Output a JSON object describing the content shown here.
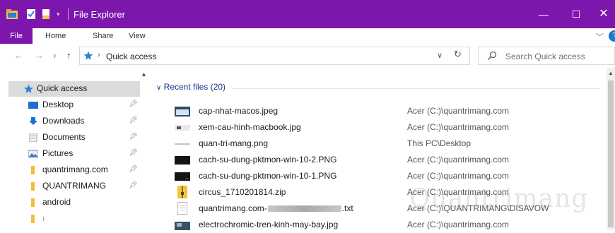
{
  "window": {
    "title": "File Explorer",
    "controls": {
      "minimize": "—",
      "maximize": "☐",
      "close": "✕"
    }
  },
  "ribbon": {
    "tabs": [
      "File",
      "Home",
      "Share",
      "View"
    ],
    "help": "?"
  },
  "address": {
    "location": "Quick access",
    "search_placeholder": "Search Quick access"
  },
  "sidebar": {
    "items": [
      {
        "label": "Quick access",
        "icon": "star-icon",
        "selected": true,
        "pinned": false
      },
      {
        "label": "Desktop",
        "icon": "desktop-icon",
        "pinned": true
      },
      {
        "label": "Downloads",
        "icon": "download-icon",
        "pinned": true
      },
      {
        "label": "Documents",
        "icon": "document-icon",
        "pinned": true
      },
      {
        "label": "Pictures",
        "icon": "picture-icon",
        "pinned": true
      },
      {
        "label": "quantrimang.com",
        "icon": "folder-icon",
        "pinned": true
      },
      {
        "label": "QUANTRIMANG",
        "icon": "folder-icon",
        "pinned": true
      },
      {
        "label": "android",
        "icon": "folder-icon",
        "pinned": false
      },
      {
        "label": "ı",
        "icon": "folder-icon",
        "pinned": false
      }
    ]
  },
  "recent": {
    "header": "Recent files (20)",
    "files": [
      {
        "name": "cap-nhat-macos.jpeg",
        "location": "Acer (C:)\\quantrimang.com",
        "icon": "image-thumb-icon"
      },
      {
        "name": "xem-cau-hinh-macbook.jpg",
        "location": "Acer (C:)\\quantrimang.com",
        "icon": "image-thumb-icon"
      },
      {
        "name": "quan-tri-mang.png",
        "location": "This PC\\Desktop",
        "icon": "image-thumb-icon"
      },
      {
        "name": "cach-su-dung-pktmon-win-10-2.PNG",
        "location": "Acer (C:)\\quantrimang.com",
        "icon": "image-thumb-icon"
      },
      {
        "name": "cach-su-dung-pktmon-win-10-1.PNG",
        "location": "Acer (C:)\\quantrimang.com",
        "icon": "image-thumb-icon"
      },
      {
        "name": "circus_1710201814.zip",
        "location": "Acer (C:)\\quantrimang.com",
        "icon": "zip-icon"
      },
      {
        "name_start": "quantrimang.com-",
        "name_end": ".txt",
        "location": "Acer (C:)\\QUANTRIMANG\\DISAVOW",
        "icon": "text-file-icon"
      },
      {
        "name": "electrochromic-tren-kinh-may-bay.jpg",
        "location": "Acer (C:)\\quantrimang.com",
        "icon": "image-thumb-icon"
      }
    ]
  },
  "watermark": "Quantrimang",
  "colors": {
    "accent": "#7d16ad",
    "group_header": "#1e3287",
    "selection": "#dbdbdb"
  }
}
